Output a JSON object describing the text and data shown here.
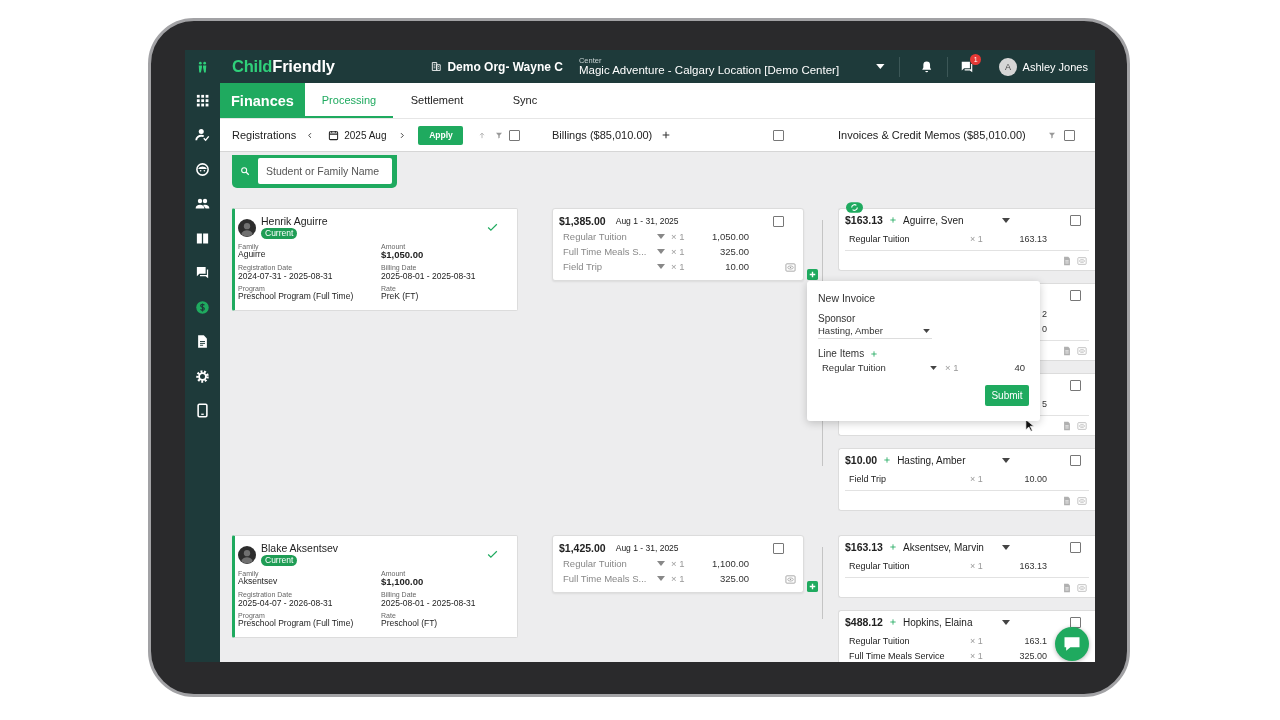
{
  "brand": {
    "part_1": "Child",
    "part_2": "Friendly"
  },
  "organization": "Demo Org- Wayne C",
  "center": {
    "label": "Center",
    "value": "Magic Adventure - Calgary Location [Demo Center]"
  },
  "messages_badge": "1",
  "user": {
    "initial": "A",
    "name": "Ashley Jones"
  },
  "sidebar": {
    "items": [
      {
        "kind": "apps",
        "selected": false
      },
      {
        "kind": "attendance",
        "selected": false
      },
      {
        "kind": "child",
        "selected": false
      },
      {
        "kind": "family",
        "selected": false
      },
      {
        "kind": "learning",
        "selected": false
      },
      {
        "kind": "messages",
        "selected": false
      },
      {
        "kind": "finance",
        "selected": true
      },
      {
        "kind": "documents",
        "selected": false
      },
      {
        "kind": "settings",
        "selected": false
      },
      {
        "kind": "tablet",
        "selected": false
      }
    ]
  },
  "module": "Finances",
  "tabs": [
    {
      "label": "Processing",
      "selected": true
    },
    {
      "label": "Settlement",
      "selected": false
    },
    {
      "label": "Sync",
      "selected": false
    }
  ],
  "toolbar": {
    "registrations": {
      "label": "Registrations",
      "period": "2025 Aug",
      "apply": "Apply",
      "checked": false
    },
    "billings": {
      "label": "Billings ($85,010.00)",
      "checked": false
    },
    "invoices": {
      "label": "Invoices & Credit Memos ($85,010.00)",
      "checked": false
    }
  },
  "search": {
    "placeholder": "Student or Family Name"
  },
  "registrations": [
    {
      "name": "Henrik Aguirre",
      "status": "Current",
      "approved": true,
      "fields": [
        {
          "label": "Family",
          "value": "Aguirre",
          "kind": "text"
        },
        {
          "label": "Amount",
          "value": "$1,050.00",
          "kind": "money"
        },
        {
          "label": "Registration Date",
          "value": "2024-07-31 - 2025-08-31",
          "kind": "text"
        },
        {
          "label": "Billing Date",
          "value": "2025-08-01 - 2025-08-31",
          "kind": "text"
        },
        {
          "label": "Program",
          "value": "Preschool Program (Full Time)",
          "kind": "text"
        },
        {
          "label": "Rate",
          "value": "PreK (FT)",
          "kind": "text"
        }
      ],
      "billing": {
        "total": "$1,385.00",
        "period": "Aug 1 - 31, 2025",
        "checked": false,
        "lines": [
          {
            "item": "Regular Tuition",
            "qty": "× 1",
            "amount": "1,050.00"
          },
          {
            "item": "Full Time Meals S...",
            "qty": "× 1",
            "amount": "325.00"
          },
          {
            "item": "Field Trip",
            "qty": "× 1",
            "amount": "10.00"
          }
        ]
      },
      "invoices": [
        {
          "total": "$163.13",
          "sponsor": "Aguirre, Sven",
          "synced": true,
          "checked": false,
          "lines": [
            {
              "item": "Regular Tuition",
              "qty": "× 1",
              "amount": "163.13"
            }
          ]
        },
        {
          "synced": false,
          "checked": false,
          "lines": [
            {
              "amount": "2"
            },
            {
              "amount": "0"
            }
          ]
        },
        {
          "synced": false,
          "checked": false,
          "lines": [
            {
              "amount": "5"
            }
          ]
        },
        {
          "total": "$10.00",
          "sponsor": "Hasting, Amber",
          "synced": false,
          "checked": false,
          "lines": [
            {
              "item": "Field Trip",
              "qty": "× 1",
              "amount": "10.00"
            }
          ]
        }
      ],
      "new_invoice": {
        "title": "New Invoice",
        "sponsor_label": "Sponsor",
        "sponsor": "Hasting, Amber",
        "line_items_label": "Line Items",
        "lines": [
          {
            "item": "Regular Tuition",
            "qty": "× 1",
            "amount": "40"
          }
        ],
        "submit": "Submit"
      }
    },
    {
      "name": "Blake Aksentsev",
      "status": "Current",
      "approved": true,
      "fields": [
        {
          "label": "Family",
          "value": "Aksentsev",
          "kind": "text"
        },
        {
          "label": "Amount",
          "value": "$1,100.00",
          "kind": "money"
        },
        {
          "label": "Registration Date",
          "value": "2025-04-07 - 2026-08-31",
          "kind": "text"
        },
        {
          "label": "Billing Date",
          "value": "2025-08-01 - 2025-08-31",
          "kind": "text"
        },
        {
          "label": "Program",
          "value": "Preschool Program (Full Time)",
          "kind": "text"
        },
        {
          "label": "Rate",
          "value": "Preschool (FT)",
          "kind": "text"
        }
      ],
      "billing": {
        "total": "$1,425.00",
        "period": "Aug 1 - 31, 2025",
        "checked": false,
        "lines": [
          {
            "item": "Regular Tuition",
            "qty": "× 1",
            "amount": "1,100.00"
          },
          {
            "item": "Full Time Meals S...",
            "qty": "× 1",
            "amount": "325.00"
          }
        ]
      },
      "invoices": [
        {
          "total": "$163.13",
          "sponsor": "Aksentsev, Marvin",
          "synced": false,
          "checked": false,
          "lines": [
            {
              "item": "Regular Tuition",
              "qty": "× 1",
              "amount": "163.13"
            }
          ]
        },
        {
          "total": "$488.12",
          "sponsor": "Hopkins, Elaina",
          "synced": false,
          "checked": false,
          "actions": false,
          "lines": [
            {
              "item": "Regular Tuition",
              "qty": "× 1",
              "amount": "163.1"
            },
            {
              "item": "Full Time Meals Service",
              "qty": "× 1",
              "amount": "325.00"
            }
          ]
        }
      ]
    }
  ]
}
